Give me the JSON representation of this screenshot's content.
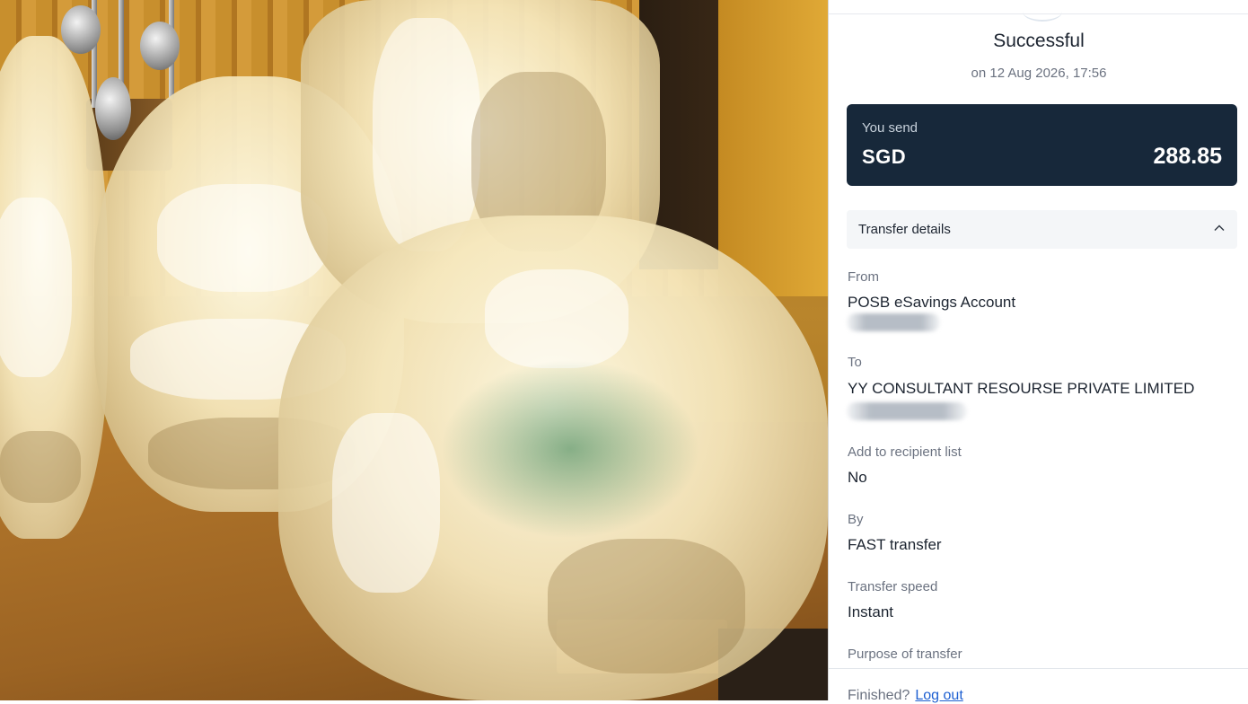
{
  "photo": {
    "description_icon": "takeaway-bags-photo"
  },
  "receipt": {
    "status_title": "Successful",
    "status_date": "on 12 Aug 2026, 17:56",
    "amount_card": {
      "label": "You send",
      "currency": "SGD",
      "amount": "288.85",
      "bg_color": "#17283a"
    },
    "details_header": {
      "label": "Transfer details",
      "icon": "chevron-up-icon"
    },
    "fields": {
      "from": {
        "label": "From",
        "value": "POSB eSavings Account"
      },
      "to": {
        "label": "To",
        "value": "YY CONSULTANT RESOURSE PRIVATE LIMITED"
      },
      "add_recipient": {
        "label": "Add to recipient list",
        "value": "No"
      },
      "by": {
        "label": "By",
        "value": "FAST transfer"
      },
      "speed": {
        "label": "Transfer speed",
        "value": "Instant"
      },
      "purpose": {
        "label": "Purpose of transfer"
      }
    },
    "footer": {
      "prompt": "Finished?",
      "link": "Log out",
      "link_color": "#1d5fd1"
    }
  }
}
